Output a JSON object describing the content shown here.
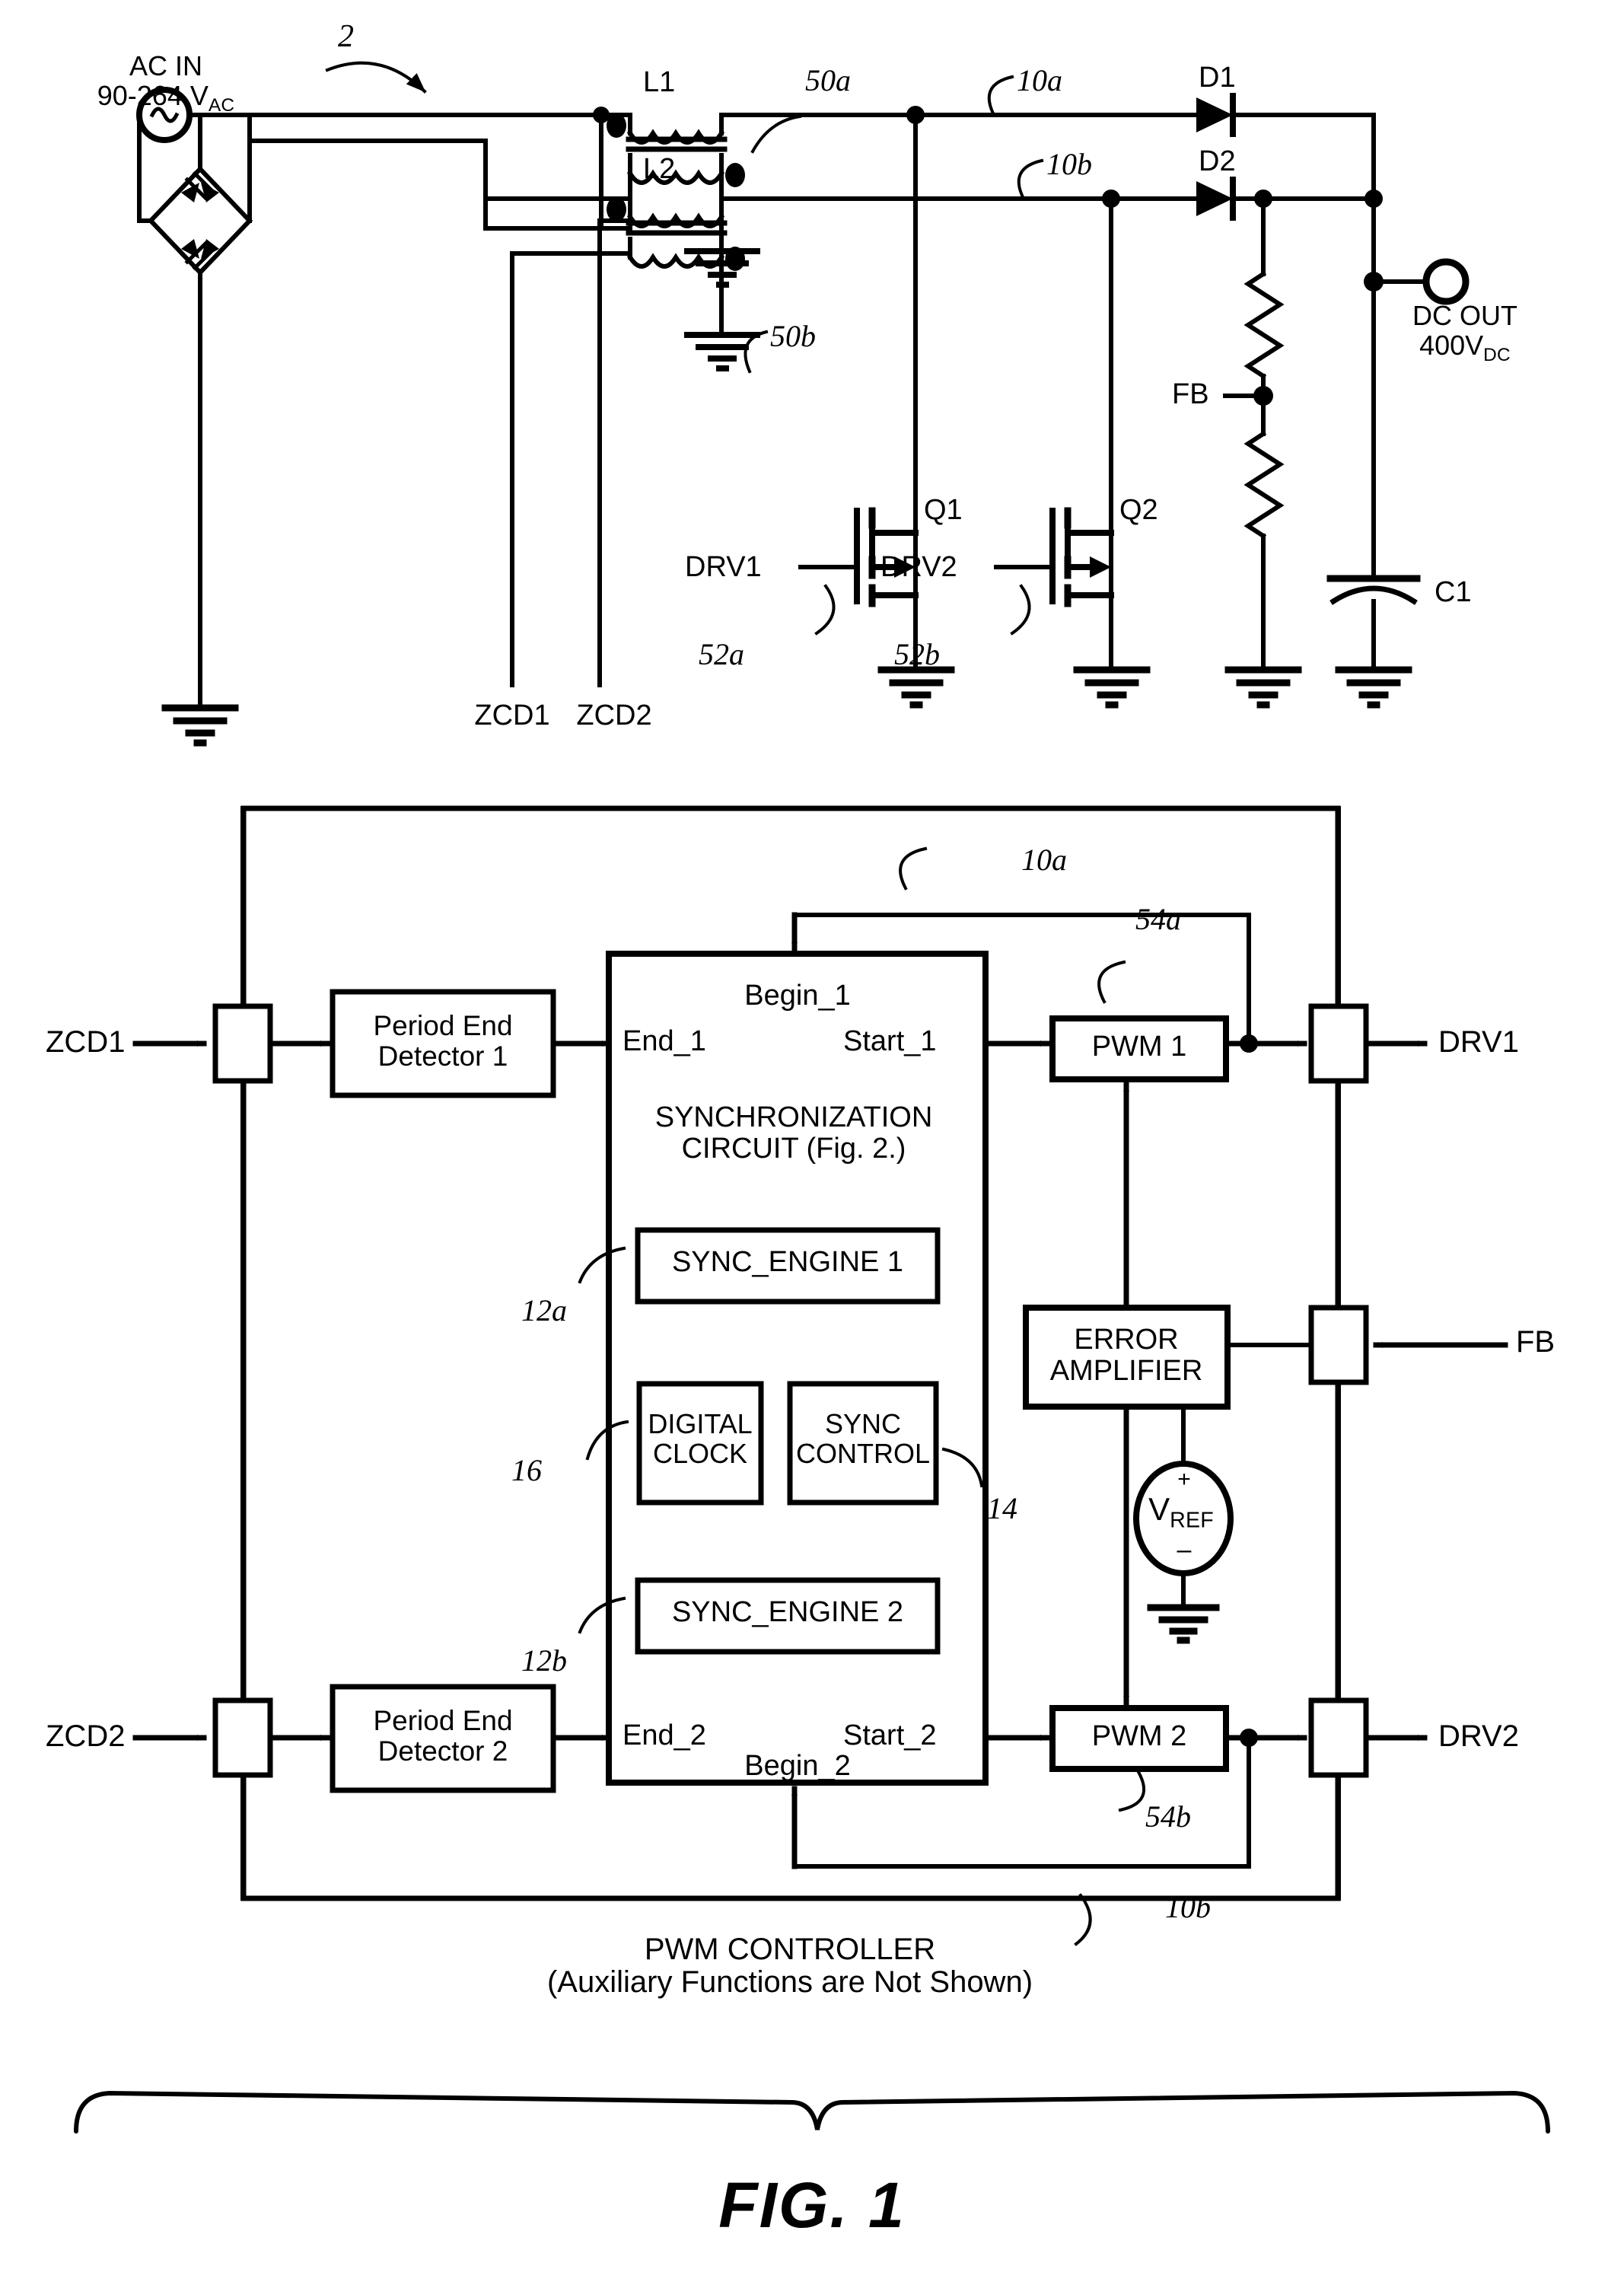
{
  "figure": {
    "caption": "FIG. 1",
    "callout_main": "2"
  },
  "power_stage": {
    "ac_input": {
      "line1": "AC IN",
      "line2_prefix": "90-264 V",
      "line2_sub": "AC"
    },
    "dc_output": {
      "line1": "DC OUT",
      "line2_prefix": "400V",
      "line2_sub": "DC"
    },
    "inductors": [
      {
        "name": "L1",
        "callout": "50a"
      },
      {
        "name": "L2",
        "callout": "50b"
      }
    ],
    "boost_nodes": [
      {
        "label": "10a"
      },
      {
        "label": "10b"
      }
    ],
    "diodes": [
      {
        "name": "D1"
      },
      {
        "name": "D2"
      }
    ],
    "transistors": [
      {
        "name": "Q1",
        "drive": "DRV1",
        "callout": "52a"
      },
      {
        "name": "Q2",
        "drive": "DRV2",
        "callout": "52b"
      }
    ],
    "feedback_node": "FB",
    "capacitor": "C1",
    "zcd_pins": [
      "ZCD1",
      "ZCD2"
    ]
  },
  "controller": {
    "title_line1": "PWM CONTROLLER",
    "title_line2": "(Auxiliary Functions are Not Shown)",
    "inputs": [
      {
        "pin_label": "ZCD1",
        "detector": {
          "line1": "Period End",
          "line2": "Detector 1"
        },
        "sync_in": "End_1"
      },
      {
        "pin_label": "ZCD2",
        "detector": {
          "line1": "Period End",
          "line2": "Detector 2"
        },
        "sync_in": "End_2"
      }
    ],
    "sync_circuit": {
      "title_line1": "SYNCHRONIZATION",
      "title_line2": "CIRCUIT (Fig. 2.)",
      "ports": {
        "begin_1": "Begin_1",
        "start_1": "Start_1",
        "begin_2": "Begin_2",
        "start_2": "Start_2"
      },
      "blocks": [
        {
          "label": "SYNC_ENGINE 1",
          "callout": "12a"
        },
        {
          "label": "DIGITAL\nCLOCK",
          "line1": "DIGITAL",
          "line2": "CLOCK",
          "callout": "16"
        },
        {
          "label": "SYNC CONTROL",
          "line1": "SYNC",
          "line2": "CONTROL",
          "callout": "14"
        },
        {
          "label": "SYNC_ENGINE 2",
          "callout": "12b"
        }
      ]
    },
    "pwm_blocks": [
      {
        "label": "PWM 1",
        "callout": "54a",
        "out_pin": "DRV1"
      },
      {
        "label": "PWM 2",
        "callout": "54b",
        "out_pin": "DRV2"
      }
    ],
    "error_amplifier": {
      "line1": "ERROR",
      "line2": "AMPLIFIER"
    },
    "vref": {
      "prefix": "V",
      "sub": "REF",
      "plus": "+",
      "minus": "–"
    },
    "fb_pin": "FB",
    "feedback_paths": [
      {
        "label": "10a"
      },
      {
        "label": "10b"
      }
    ]
  }
}
